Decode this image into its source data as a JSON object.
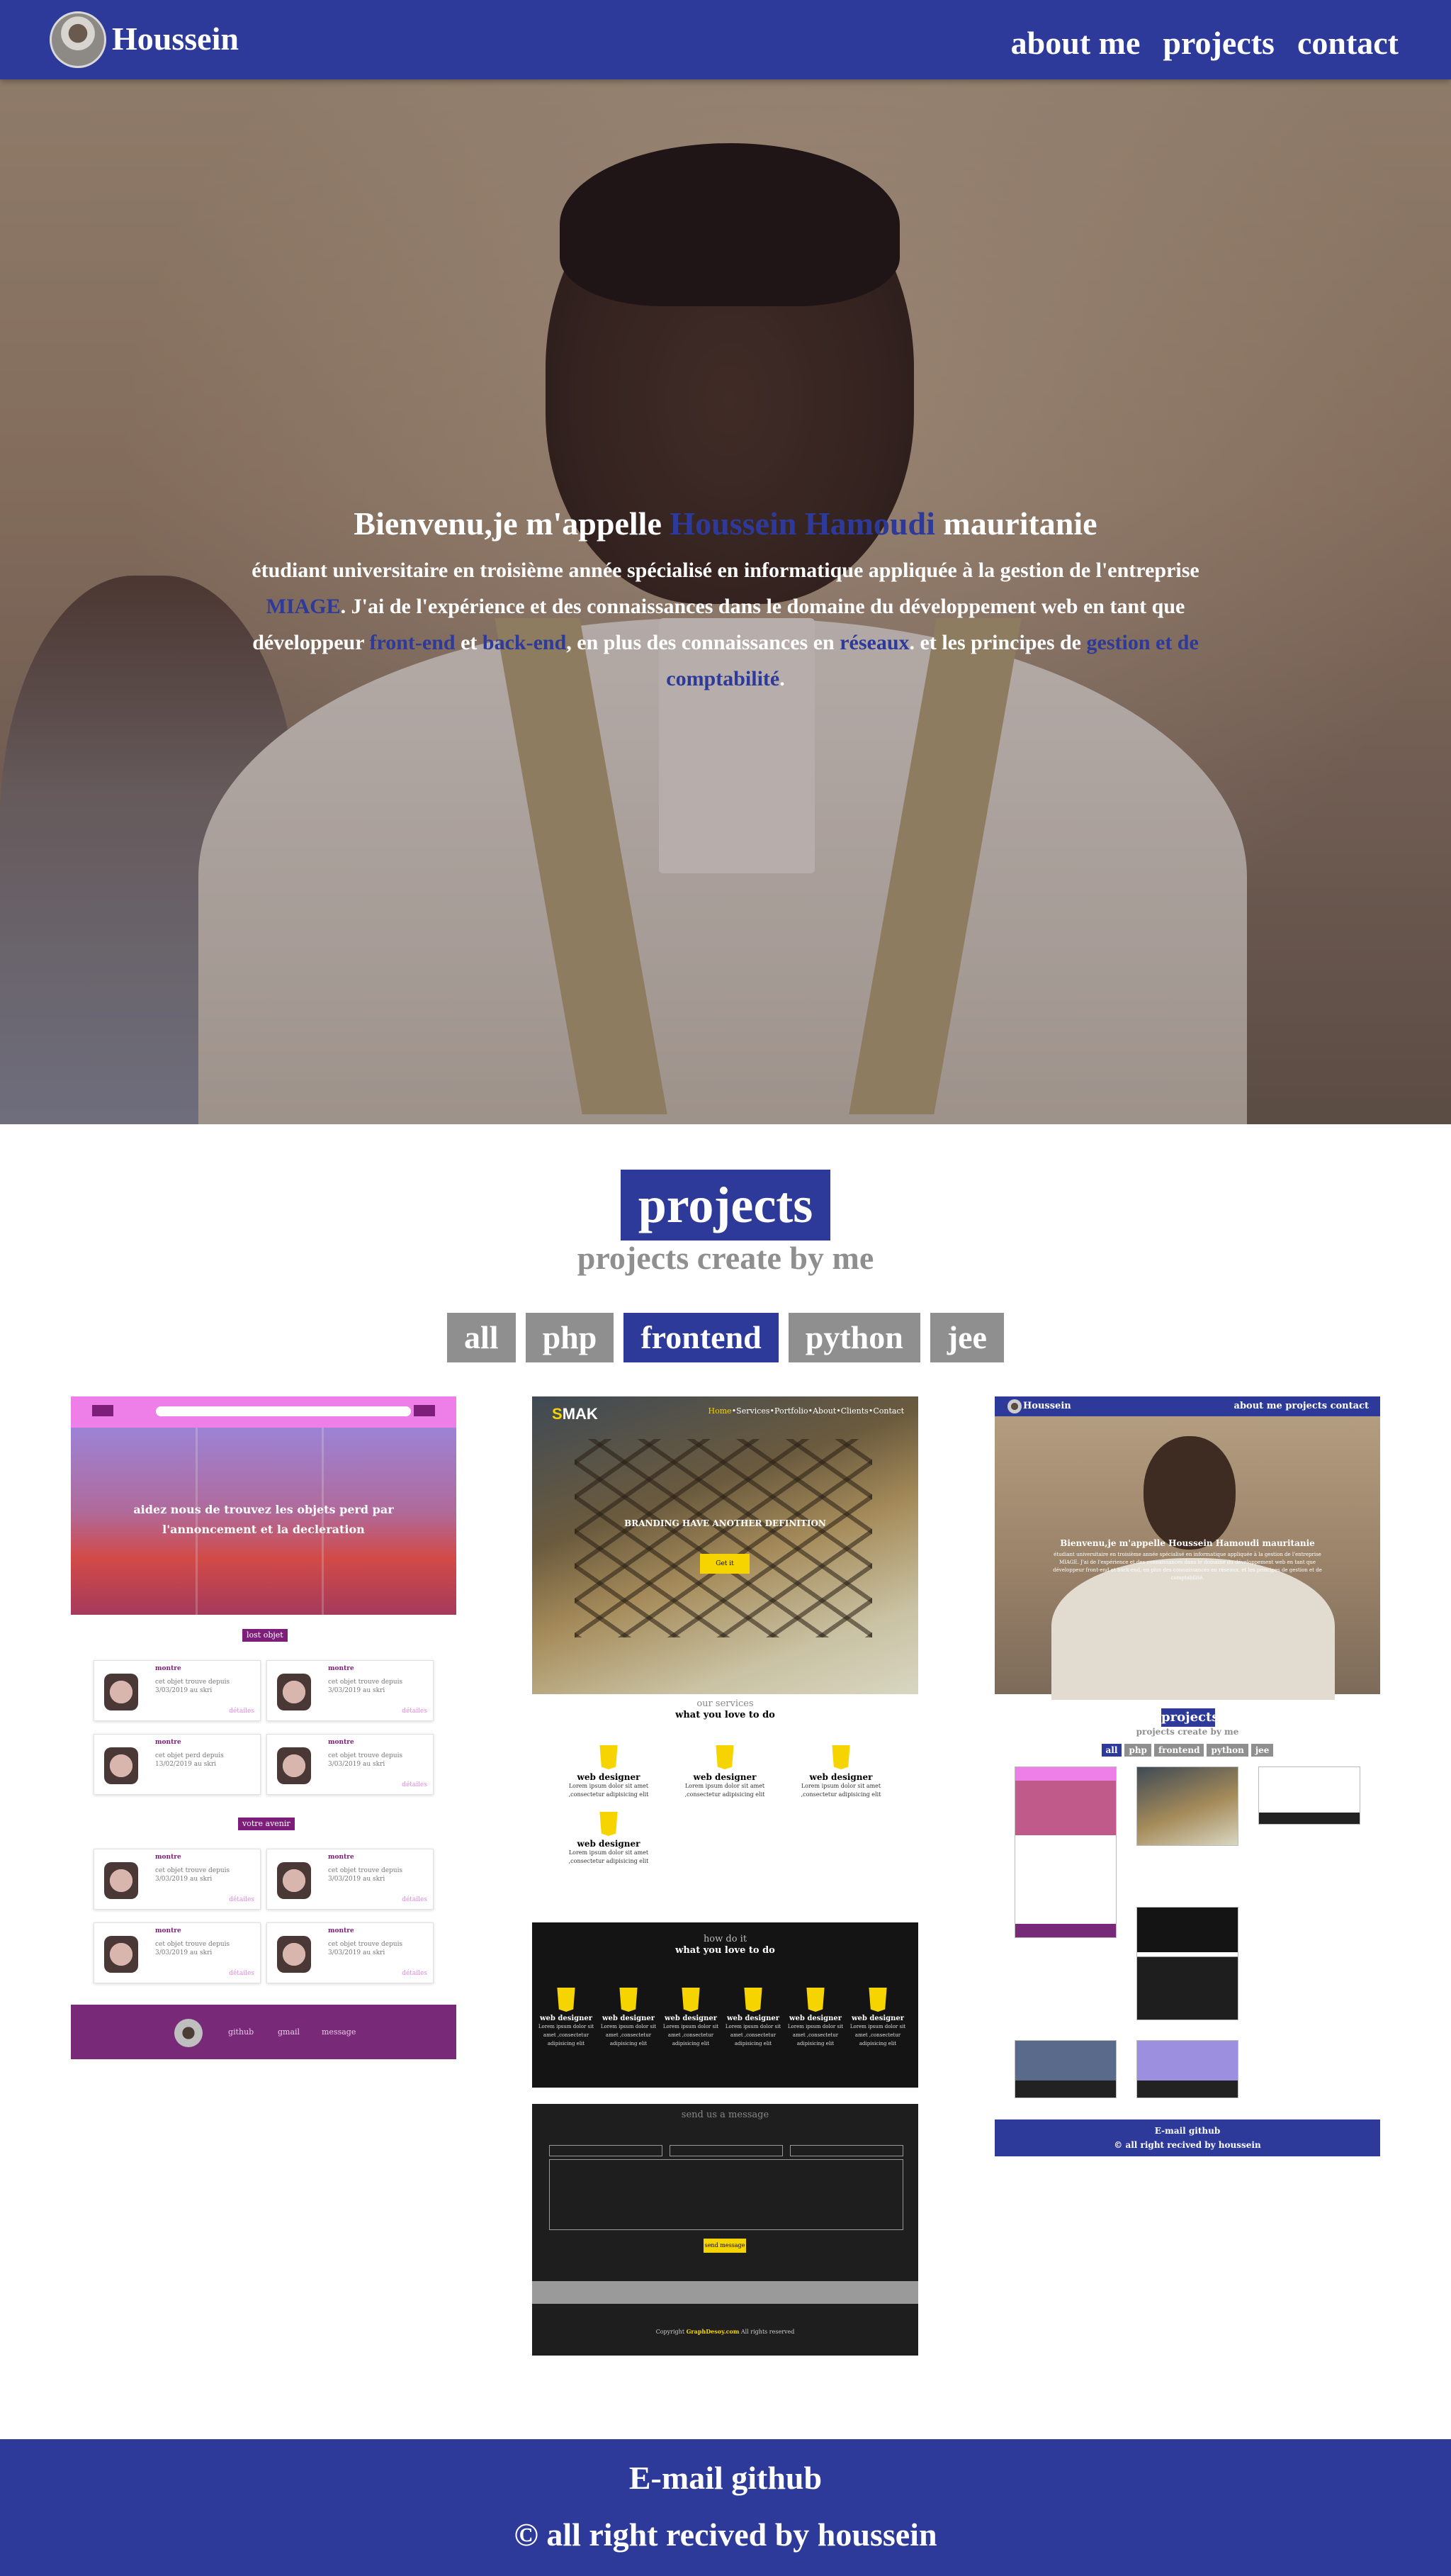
{
  "nav": {
    "brand": "Houssein",
    "links": [
      "about me",
      "projects",
      "contact"
    ]
  },
  "hero": {
    "greeting": "Bienvenu,je m'appelle",
    "name": "Houssein Hamoudi",
    "country": "mauritanie",
    "line1": "étudiant universitaire en troisième année spécialisé en informatique appliquée à la gestion de l'entreprise",
    "miage": "MIAGE",
    "line2": ". J'ai de l'expérience et des connaissances dans le domaine du développement web en tant que",
    "dev": "développeur",
    "frontend": "front-end",
    "et": "et",
    "backend": "back-end",
    "line3": ", en plus des connaissances en",
    "reseaux": "réseaux",
    "line4": ". et les principes de",
    "gestion": "gestion et de comptabilité",
    "dot": "."
  },
  "projects": {
    "title": "projects",
    "subtitle": "projects create by me",
    "filters": [
      "all",
      "php",
      "frontend",
      "python",
      "jee"
    ],
    "active_filter": "frontend"
  },
  "card1": {
    "top_left": "ajout",
    "top_right": "search",
    "banner_caption": "aidez nous de trouvez les objets perd par l'annoncement et la decleration",
    "label_lost": "lost objet",
    "label_found": "votre avenir",
    "item_name": "montre",
    "item_desc1": "cet objet trouve depuis 3/03/2019 au skri",
    "item_desc2": "cet objet perd depuis 13/02/2019 au skri",
    "details": "détailes",
    "footer_links": [
      "github",
      "gmail",
      "message"
    ]
  },
  "card2": {
    "logo_prefix": "S",
    "logo_rest": "MAK",
    "menu_active": "Home",
    "menu": "•Services•Portfolio•About•Clients•Contact",
    "hero_text": "BRANDING HAVE ANOTHER DEFINITION",
    "get_it": "Get it",
    "services_title": "our services",
    "services_sub": "what you love to do",
    "service_name": "web designer",
    "service_text": "Lorem ipsum dolor sit amet ,consectetur adipisicing elit",
    "how_title": "how do it",
    "how_sub": "what you love to do",
    "contact_title": "send us a message",
    "send_btn": "send message",
    "copyright_prefix": "Copyright",
    "copyright_brand": "GraphDesoy.com",
    "copyright_suffix": "All rights reserved"
  },
  "card3": {
    "brand": "Houssein",
    "links": "about me  projects  contact",
    "hero_line": "Bienvenu,je m'appelle Houssein Hamoudi mauritanie",
    "hero_text": "étudiant universitaire en troisième année spécialisé en informatique appliquée à la gestion de l'entreprise MIAGE. J'ai de l'expérience et des connaissances dans le domaine du développement web en tant que développeur front-end et back-end, en plus des connaissances en réseaux. et les principes de gestion et de comptabilité.",
    "title": "projects",
    "subtitle": "projects create by me",
    "filters": [
      "all",
      "php",
      "frontend",
      "python",
      "jee"
    ],
    "footer1": "E-mail github",
    "footer2": "© all right recived by houssein"
  },
  "footer": {
    "line1": "E-mail github",
    "line2": "© all right recived by houssein"
  },
  "colors": {
    "primary": "#2d3a9a",
    "grey": "#8f8f8f",
    "pink": "#ee7fe8",
    "purple": "#782a78",
    "yellow": "#f5d400"
  }
}
